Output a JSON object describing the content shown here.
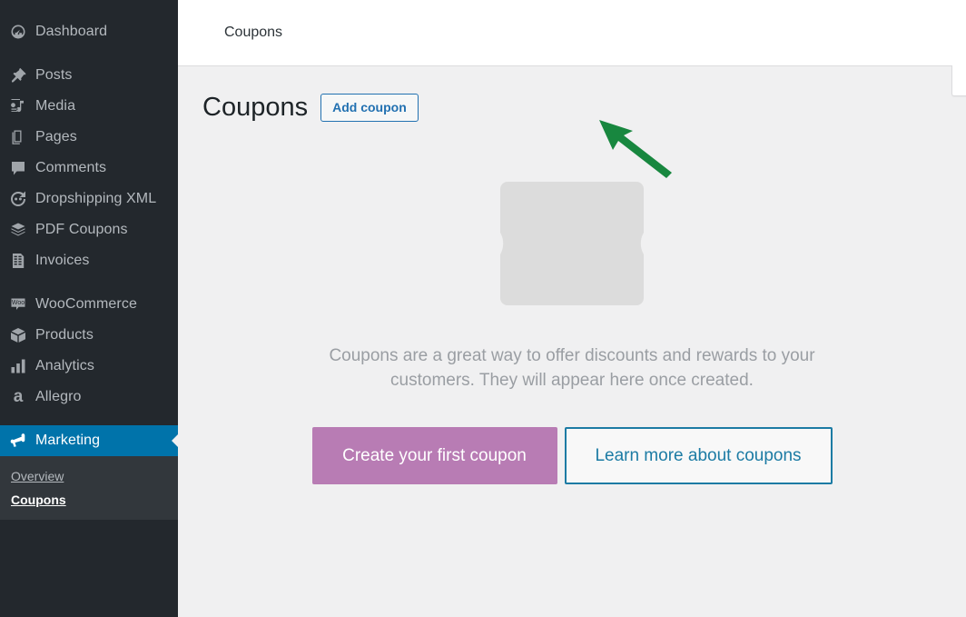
{
  "sidebar": {
    "items": [
      {
        "label": "Dashboard",
        "icon": "dashboard-icon",
        "current": false
      },
      {
        "label": "Posts",
        "icon": "pin-icon",
        "current": false
      },
      {
        "label": "Media",
        "icon": "media-icon",
        "current": false
      },
      {
        "label": "Pages",
        "icon": "pages-icon",
        "current": false
      },
      {
        "label": "Comments",
        "icon": "comments-icon",
        "current": false
      },
      {
        "label": "Dropshipping XML",
        "icon": "sync-icon",
        "current": false
      },
      {
        "label": "PDF Coupons",
        "icon": "pdf-coupons-icon",
        "current": false
      },
      {
        "label": "Invoices",
        "icon": "invoice-icon",
        "current": false
      },
      {
        "label": "WooCommerce",
        "icon": "woocommerce-icon",
        "current": false
      },
      {
        "label": "Products",
        "icon": "products-box-icon",
        "current": false
      },
      {
        "label": "Analytics",
        "icon": "analytics-bars-icon",
        "current": false
      },
      {
        "label": "Allegro",
        "icon": "allegro-a-icon",
        "current": false
      },
      {
        "label": "Marketing",
        "icon": "megaphone-icon",
        "current": true
      }
    ],
    "submenu": [
      {
        "label": "Overview",
        "active": false
      },
      {
        "label": "Coupons",
        "active": true
      }
    ],
    "colors": {
      "background": "#23282d",
      "submenu_background": "#32373c",
      "current_highlight": "#0073aa",
      "text": "#b4b9be"
    }
  },
  "header": {
    "breadcrumb": "Coupons"
  },
  "page": {
    "title": "Coupons",
    "add_button_label": "Add coupon"
  },
  "empty_state": {
    "graphic": "coupon-ticket-icon",
    "message": "Coupons are a great way to offer discounts and rewards to your customers. They will appear here once created.",
    "primary_button_label": "Create your first coupon",
    "secondary_button_label": "Learn more about coupons",
    "colors": {
      "primary_button": "#b87cb4",
      "secondary_border": "#1c7ba4",
      "graphic": "#dcdcdc",
      "message_text": "#9a9ea3"
    }
  },
  "annotation": {
    "type": "arrow",
    "color": "#18873f",
    "points_to": "Add coupon"
  }
}
